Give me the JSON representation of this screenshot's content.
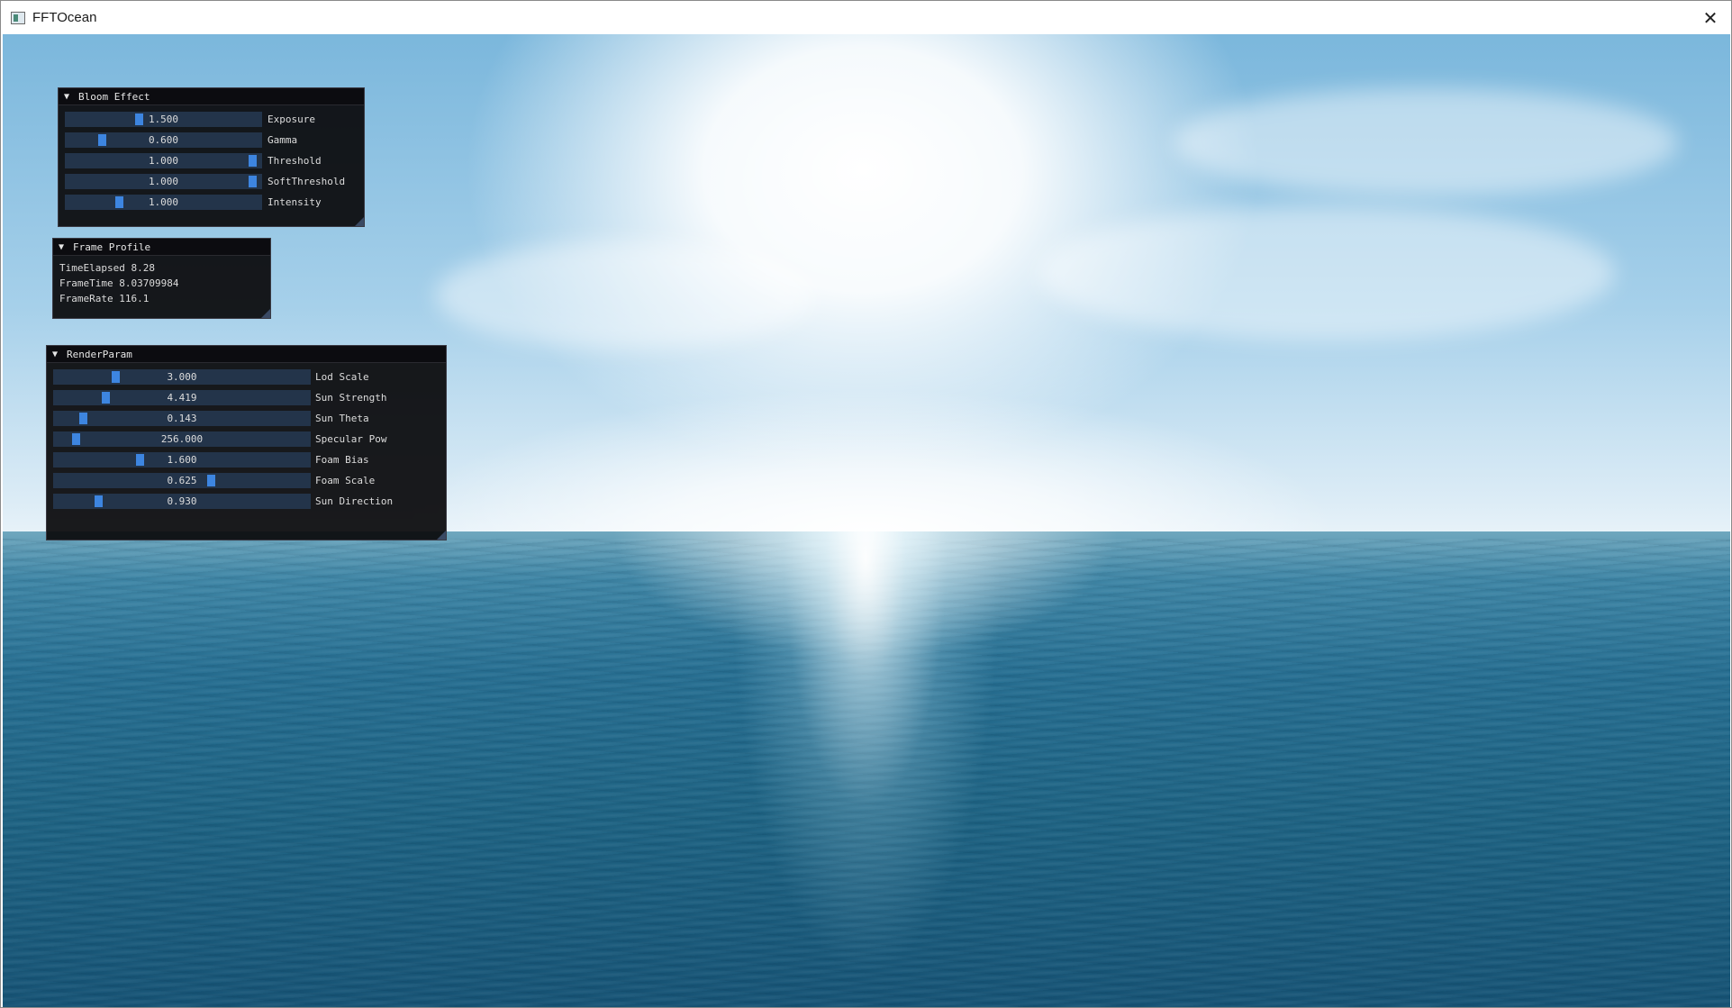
{
  "window": {
    "title": "FFTOcean",
    "icon": "app-window-icon",
    "close_glyph": "✕"
  },
  "bloom": {
    "title": "Bloom Effect",
    "collapse_glyph": "▼",
    "sliders": [
      {
        "label": "Exposure",
        "value": "1.500",
        "level": 0.37
      },
      {
        "label": "Gamma",
        "value": "0.600",
        "level": 0.17
      },
      {
        "label": "Threshold",
        "value": "1.000",
        "level": 0.98
      },
      {
        "label": "SoftThreshold",
        "value": "1.000",
        "level": 0.98
      },
      {
        "label": "Intensity",
        "value": "1.000",
        "level": 0.26
      }
    ]
  },
  "profile": {
    "title": "Frame Profile",
    "collapse_glyph": "▼",
    "lines": [
      "TimeElapsed 8.28",
      "FrameTime 8.03709984",
      "FrameRate 116.1"
    ]
  },
  "render": {
    "title": "RenderParam",
    "collapse_glyph": "▼",
    "sliders": [
      {
        "label": "Lod Scale",
        "value": "3.000",
        "level": 0.23
      },
      {
        "label": "Sun Strength",
        "value": "4.419",
        "level": 0.19
      },
      {
        "label": "Sun Theta",
        "value": "0.143",
        "level": 0.1
      },
      {
        "label": "Specular Pow",
        "value": "256.000",
        "level": 0.07
      },
      {
        "label": "Foam Bias",
        "value": "1.600",
        "level": 0.33
      },
      {
        "label": "Foam Scale",
        "value": "0.625",
        "level": 0.62
      },
      {
        "label": "Sun Direction",
        "value": "0.930",
        "level": 0.16
      }
    ]
  },
  "colors": {
    "slider_grab": "#3d85e0",
    "slider_track": "#23344a",
    "panel_bg": "#0c0c0e"
  }
}
